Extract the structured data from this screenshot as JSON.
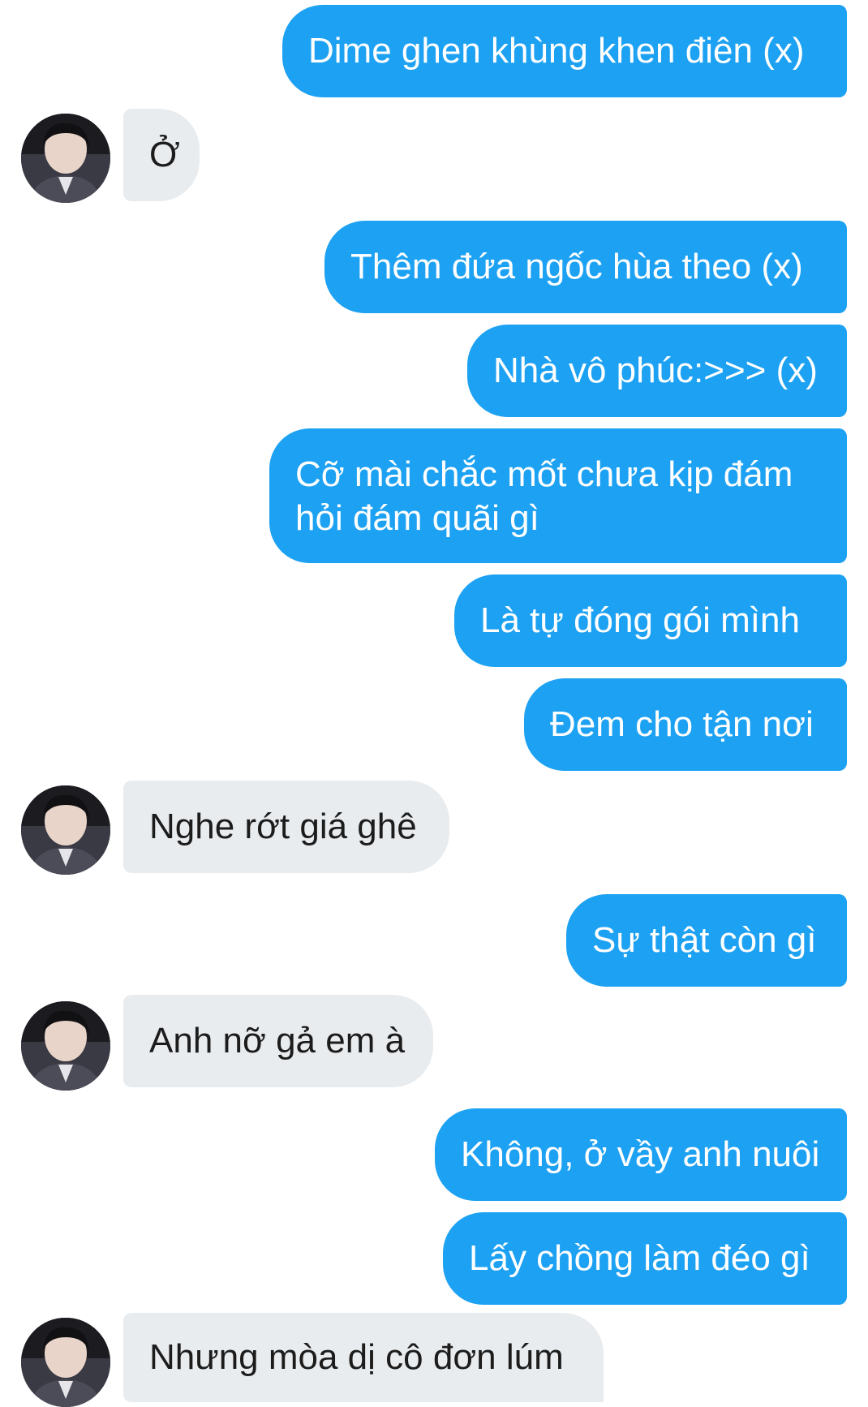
{
  "messages": [
    {
      "side": "sent",
      "text": "Dime ghen khùng khen điên (x)"
    },
    {
      "side": "received",
      "text": "Ở"
    },
    {
      "side": "sent",
      "text": "Thêm đứa ngốc hùa theo (x)"
    },
    {
      "side": "sent",
      "text": "Nhà vô phúc:>>> (x)"
    },
    {
      "side": "sent",
      "text": "Cỡ mài chắc mốt chưa kịp đám hỏi đám quãi gì"
    },
    {
      "side": "sent",
      "text": "Là tự đóng gói mình"
    },
    {
      "side": "sent",
      "text": "Đem cho tận nơi"
    },
    {
      "side": "received",
      "text": "Nghe rớt giá ghê"
    },
    {
      "side": "sent",
      "text": "Sự thật còn gì"
    },
    {
      "side": "received",
      "text": "Anh nỡ gả em à"
    },
    {
      "side": "sent",
      "text": "Không, ở vầy anh nuôi"
    },
    {
      "side": "sent",
      "text": "Lấy chồng làm đéo gì"
    },
    {
      "side": "received",
      "text": "Nhưng mòa dị cô đơn lúm"
    }
  ],
  "colors": {
    "sent_bubble": "#1da1f2",
    "sent_text": "#ffffff",
    "received_bubble": "#e9ecef",
    "received_text": "#1c1c1c"
  }
}
